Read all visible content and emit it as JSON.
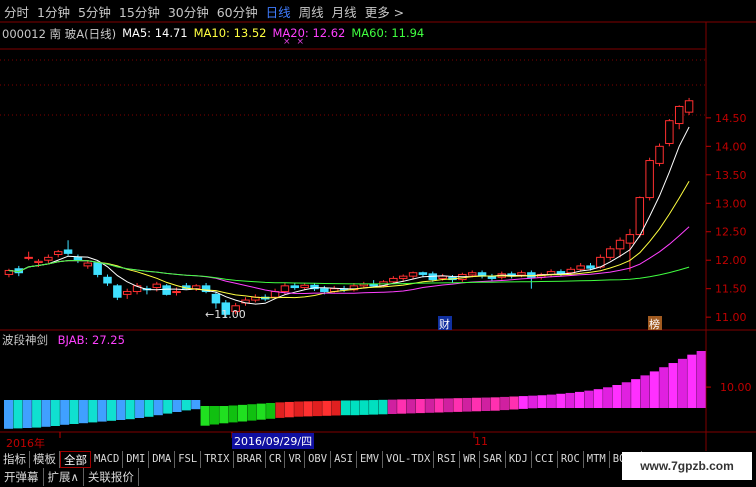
{
  "periods": [
    "分时",
    "1分钟",
    "5分钟",
    "15分钟",
    "30分钟",
    "60分钟",
    "日线",
    "周线",
    "月线",
    "更多 >"
  ],
  "active_period": "日线",
  "stock": {
    "code_name": "000012 南 玻A(日线)"
  },
  "ma": [
    {
      "label": "MA5: 14.71",
      "color": "#ffffff"
    },
    {
      "label": "MA10: 13.52",
      "color": "#ffff40"
    },
    {
      "label": "MA20: 12.62",
      "color": "#ff40ff"
    },
    {
      "label": "MA60: 11.94",
      "color": "#40ff40"
    }
  ],
  "indicator": {
    "name": "波段神剑",
    "value_label": "BJAB: 27.25",
    "value_color": "#ff40ff"
  },
  "price_axis": [
    "14.50",
    "14.00",
    "13.50",
    "13.00",
    "12.50",
    "12.00",
    "11.50",
    "11.00"
  ],
  "indicator_axis": [
    "10.00"
  ],
  "annotations": {
    "low_label": "←11.00",
    "cai": "财",
    "bang": "榜"
  },
  "date_axis": {
    "year": "2016年",
    "cursor": "2016/09/29/四",
    "month": "11"
  },
  "tabs": [
    "指标",
    "模板",
    "全部",
    "MACD",
    "DMI",
    "DMA",
    "FSL",
    "TRIX",
    "BRAR",
    "CR",
    "VR",
    "OBV",
    "ASI",
    "EMV",
    "VOL-TDX",
    "RSI",
    "WR",
    "SAR",
    "KDJ",
    "CCI",
    "ROC",
    "MTM",
    "BOLL"
  ],
  "active_tab": "全部",
  "bottom": [
    "开弹幕",
    "扩展∧",
    "关联报价"
  ],
  "watermark": "www.7gpzb.com",
  "colors": {
    "up": "#ff3030",
    "down": "#40e0ff",
    "grid": "#800000",
    "accent": "#3f7cff"
  },
  "candles": [
    [
      11.75,
      11.82,
      11.7,
      11.85
    ],
    [
      11.85,
      11.78,
      11.72,
      11.9
    ],
    [
      12.05,
      12.05,
      12.0,
      12.15
    ],
    [
      11.96,
      11.98,
      11.88,
      12.02
    ],
    [
      12.0,
      12.05,
      11.95,
      12.1
    ],
    [
      12.1,
      12.15,
      12.05,
      12.18
    ],
    [
      12.18,
      12.12,
      12.08,
      12.35
    ],
    [
      12.05,
      12.0,
      11.95,
      12.1
    ],
    [
      11.9,
      11.95,
      11.85,
      12.0
    ],
    [
      11.95,
      11.75,
      11.7,
      11.98
    ],
    [
      11.7,
      11.6,
      11.55,
      11.75
    ],
    [
      11.55,
      11.35,
      11.3,
      11.58
    ],
    [
      11.4,
      11.45,
      11.32,
      11.5
    ],
    [
      11.45,
      11.55,
      11.4,
      11.6
    ],
    [
      11.5,
      11.48,
      11.4,
      11.55
    ],
    [
      11.52,
      11.58,
      11.45,
      11.62
    ],
    [
      11.55,
      11.4,
      11.38,
      11.58
    ],
    [
      11.45,
      11.45,
      11.38,
      11.52
    ],
    [
      11.55,
      11.5,
      11.48,
      11.6
    ],
    [
      11.5,
      11.55,
      11.46,
      11.58
    ],
    [
      11.55,
      11.45,
      11.42,
      11.6
    ],
    [
      11.4,
      11.25,
      11.15,
      11.45
    ],
    [
      11.25,
      11.05,
      11.0,
      11.3
    ],
    [
      11.1,
      11.2,
      11.05,
      11.25
    ],
    [
      11.25,
      11.3,
      11.2,
      11.35
    ],
    [
      11.3,
      11.35,
      11.26,
      11.4
    ],
    [
      11.35,
      11.32,
      11.28,
      11.4
    ],
    [
      11.35,
      11.45,
      11.32,
      11.5
    ],
    [
      11.45,
      11.55,
      11.4,
      11.6
    ],
    [
      11.55,
      11.52,
      11.48,
      11.6
    ],
    [
      11.52,
      11.56,
      11.48,
      11.6
    ],
    [
      11.56,
      11.5,
      11.46,
      11.6
    ],
    [
      11.5,
      11.45,
      11.4,
      11.55
    ],
    [
      11.45,
      11.5,
      11.42,
      11.55
    ],
    [
      11.5,
      11.48,
      11.44,
      11.55
    ],
    [
      11.48,
      11.55,
      11.45,
      11.6
    ],
    [
      11.55,
      11.58,
      11.5,
      11.62
    ],
    [
      11.58,
      11.55,
      11.52,
      11.65
    ],
    [
      11.55,
      11.62,
      11.52,
      11.65
    ],
    [
      11.62,
      11.68,
      11.58,
      11.72
    ],
    [
      11.68,
      11.72,
      11.62,
      11.75
    ],
    [
      11.72,
      11.78,
      11.66,
      11.8
    ],
    [
      11.78,
      11.75,
      11.7,
      11.8
    ],
    [
      11.76,
      11.66,
      11.62,
      11.8
    ],
    [
      11.68,
      11.72,
      11.64,
      11.76
    ],
    [
      11.7,
      11.66,
      11.6,
      11.74
    ],
    [
      11.66,
      11.75,
      11.62,
      11.78
    ],
    [
      11.74,
      11.78,
      11.7,
      11.82
    ],
    [
      11.78,
      11.72,
      11.68,
      11.82
    ],
    [
      11.72,
      11.68,
      11.64,
      11.76
    ],
    [
      11.7,
      11.76,
      11.66,
      11.8
    ],
    [
      11.76,
      11.72,
      11.68,
      11.8
    ],
    [
      11.74,
      11.78,
      11.7,
      11.82
    ],
    [
      11.78,
      11.7,
      11.5,
      11.82
    ],
    [
      11.7,
      11.75,
      11.66,
      11.78
    ],
    [
      11.75,
      11.8,
      11.7,
      11.84
    ],
    [
      11.8,
      11.76,
      11.72,
      11.84
    ],
    [
      11.78,
      11.84,
      11.74,
      11.88
    ],
    [
      11.84,
      11.9,
      11.8,
      11.95
    ],
    [
      11.9,
      11.86,
      11.82,
      11.95
    ],
    [
      11.88,
      12.05,
      11.85,
      12.1
    ],
    [
      12.05,
      12.2,
      12.0,
      12.25
    ],
    [
      12.2,
      12.35,
      12.05,
      12.4
    ],
    [
      12.3,
      12.45,
      11.8,
      12.55
    ],
    [
      12.45,
      13.1,
      12.4,
      13.12
    ],
    [
      13.1,
      13.75,
      13.05,
      13.8
    ],
    [
      13.7,
      14.0,
      13.65,
      14.05
    ],
    [
      14.05,
      14.45,
      14.0,
      14.48
    ],
    [
      14.4,
      14.7,
      14.3,
      14.72
    ],
    [
      14.6,
      14.8,
      14.55,
      14.85
    ]
  ],
  "bjab": [
    -5.2,
    -5.1,
    -5.0,
    -4.9,
    -4.7,
    -4.5,
    -4.2,
    -4.0,
    -3.8,
    -3.6,
    -3.4,
    -3.2,
    -3.0,
    -2.8,
    -2.5,
    -2.2,
    -1.8,
    -1.4,
    -1.0,
    -0.6,
    -0.3,
    0.1,
    0.5,
    0.9,
    1.2,
    1.5,
    1.8,
    2.1,
    2.4,
    2.7,
    2.9,
    3.1,
    3.2,
    3.3,
    3.4,
    3.5,
    3.6,
    3.6,
    3.7,
    3.8,
    3.9,
    4.0,
    4.1,
    4.2,
    4.3,
    4.4,
    4.5,
    4.6,
    4.7,
    4.8,
    4.9,
    5.0,
    5.1,
    5.3,
    5.5,
    5.7,
    5.9,
    6.1,
    6.4,
    6.8,
    7.2,
    7.7,
    8.3,
    9.0,
    9.9,
    11.0,
    12.3,
    13.8,
    15.6,
    17.5,
    19.5,
    21.5,
    23.5,
    25.5,
    27.25
  ]
}
